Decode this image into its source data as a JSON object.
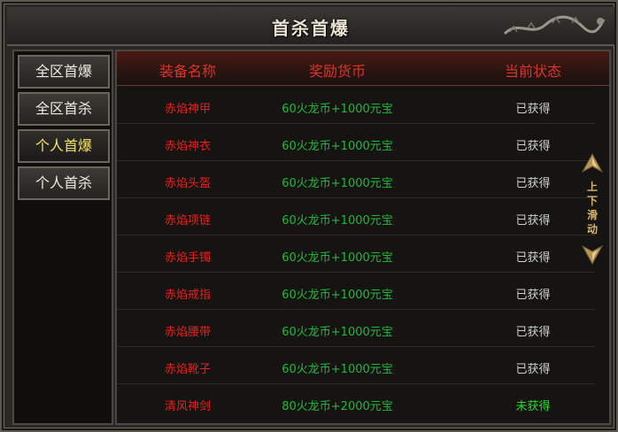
{
  "window": {
    "title": "首杀首爆"
  },
  "sidebar": {
    "tabs": [
      {
        "label": "全区首爆",
        "active": false
      },
      {
        "label": "全区首杀",
        "active": false
      },
      {
        "label": "个人首爆",
        "active": true
      },
      {
        "label": "个人首杀",
        "active": false
      }
    ]
  },
  "table": {
    "headers": [
      "装备名称",
      "奖励货币",
      "当前状态"
    ],
    "rows": [
      {
        "name": "赤焰神甲",
        "reward": "60火龙币+1000元宝",
        "status": "已获得"
      },
      {
        "name": "赤焰神衣",
        "reward": "60火龙币+1000元宝",
        "status": "已获得"
      },
      {
        "name": "赤焰头盔",
        "reward": "60火龙币+1000元宝",
        "status": "已获得"
      },
      {
        "name": "赤焰项链",
        "reward": "60火龙币+1000元宝",
        "status": "已获得"
      },
      {
        "name": "赤焰手镯",
        "reward": "60火龙币+1000元宝",
        "status": "已获得"
      },
      {
        "name": "赤焰戒指",
        "reward": "60火龙币+1000元宝",
        "status": "已获得"
      },
      {
        "name": "赤焰腰带",
        "reward": "60火龙币+1000元宝",
        "status": "已获得"
      },
      {
        "name": "赤焰靴子",
        "reward": "60火龙币+1000元宝",
        "status": "已获得"
      },
      {
        "name": "清风神剑",
        "reward": "80火龙币+2000元宝",
        "status": "未获得"
      }
    ]
  },
  "scroll_hint": {
    "chars": [
      "上",
      "下",
      "滑",
      "动"
    ]
  },
  "colors": {
    "item_name": "#e8201c",
    "reward": "#21b83a",
    "status_obtained": "#cfcfcf",
    "status_not_obtained": "#22e01e",
    "header_text": "#d8352a",
    "active_tab": "#f2e26a"
  }
}
